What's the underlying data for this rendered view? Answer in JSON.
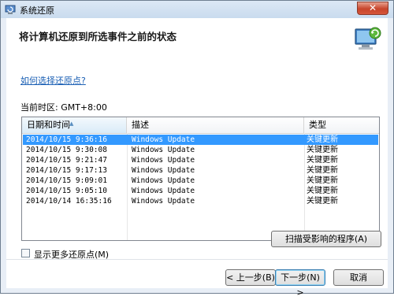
{
  "window": {
    "title": "系统还原",
    "close_symbol": "✕"
  },
  "header": {
    "text": "将计算机还原到所选事件之前的状态"
  },
  "help_link": "如何选择还原点?",
  "timezone": "当前时区: GMT+8:00",
  "table": {
    "columns": [
      "日期和时间",
      "描述",
      "类型"
    ],
    "rows": [
      {
        "date": "2014/10/15 9:36:16",
        "desc": "Windows Update",
        "type": "关键更新",
        "selected": true
      },
      {
        "date": "2014/10/15 9:30:08",
        "desc": "Windows Update",
        "type": "关键更新"
      },
      {
        "date": "2014/10/15 9:21:47",
        "desc": "Windows Update",
        "type": "关键更新"
      },
      {
        "date": "2014/10/15 9:17:13",
        "desc": "Windows Update",
        "type": "关键更新"
      },
      {
        "date": "2014/10/15 9:09:01",
        "desc": "Windows Update",
        "type": "关键更新"
      },
      {
        "date": "2014/10/15 9:05:10",
        "desc": "Windows Update",
        "type": "关键更新"
      },
      {
        "date": "2014/10/14 16:35:16",
        "desc": "Windows Update",
        "type": "关键更新"
      }
    ]
  },
  "show_more_checkbox": {
    "label": "显示更多还原点(M)",
    "checked": false
  },
  "buttons": {
    "scan": "扫描受影响的程序(A)",
    "back": "< 上一步(B)",
    "next": "下一步(N) >",
    "cancel": "取消"
  },
  "colors": {
    "selection": "#3399ff",
    "link": "#1a5fb4"
  }
}
